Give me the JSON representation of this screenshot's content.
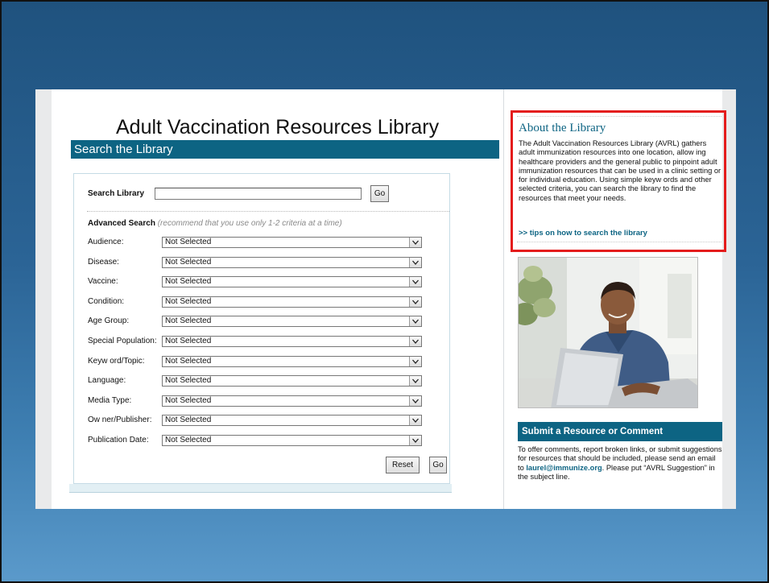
{
  "page": {
    "title": "Adult Vaccination Resources Library",
    "search_section_title": "Search the Library"
  },
  "search": {
    "label": "Search Library",
    "input_value": "",
    "go_label": "Go"
  },
  "advanced": {
    "heading": "Advanced Search",
    "note": "(recommend that you use only 1-2 criteria at a time)",
    "filters": [
      {
        "label": "Audience:",
        "value": "Not Selected"
      },
      {
        "label": "Disease:",
        "value": "Not Selected"
      },
      {
        "label": "Vaccine:",
        "value": "Not Selected"
      },
      {
        "label": "Condition:",
        "value": "Not Selected"
      },
      {
        "label": "Age Group:",
        "value": "Not Selected"
      },
      {
        "label": "Special Population:",
        "value": "Not Selected"
      },
      {
        "label": "Keyw ord/Topic:",
        "value": "Not Selected"
      },
      {
        "label": "Language:",
        "value": "Not Selected"
      },
      {
        "label": "Media Type:",
        "value": "Not Selected"
      },
      {
        "label": "Ow ner/Publisher:",
        "value": "Not Selected"
      },
      {
        "label": "Publication Date:",
        "value": "Not Selected"
      }
    ],
    "reset_label": "Reset",
    "go_label": "Go"
  },
  "about": {
    "title": "About the Library",
    "text": "The Adult Vaccination Resources Library (AVRL) gathers adult immunization resources into one location, allow ing healthcare providers and the general public to pinpoint adult immunization resources that can be used in a clinic setting or for individual education. Using simple keyw ords and other selected criteria, you can search the library to find the resources that meet your needs.",
    "tips_link": ">> tips on how to search the library"
  },
  "photo": {
    "subject": "man using laptop"
  },
  "submit": {
    "title": "Submit a Resource or Comment",
    "text_before": "To offer comments, report broken links, or submit suggestions for resources that should be included, please send an email to ",
    "email": "laurel@immunize.org",
    "text_after": ". Please put “AVRL Suggestion” in the subject line."
  },
  "colors": {
    "brand_teal": "#0d6483",
    "highlight_red": "#e41c1c",
    "slide_blue_top": "#1f527e",
    "slide_blue_bottom": "#5b9acb"
  }
}
